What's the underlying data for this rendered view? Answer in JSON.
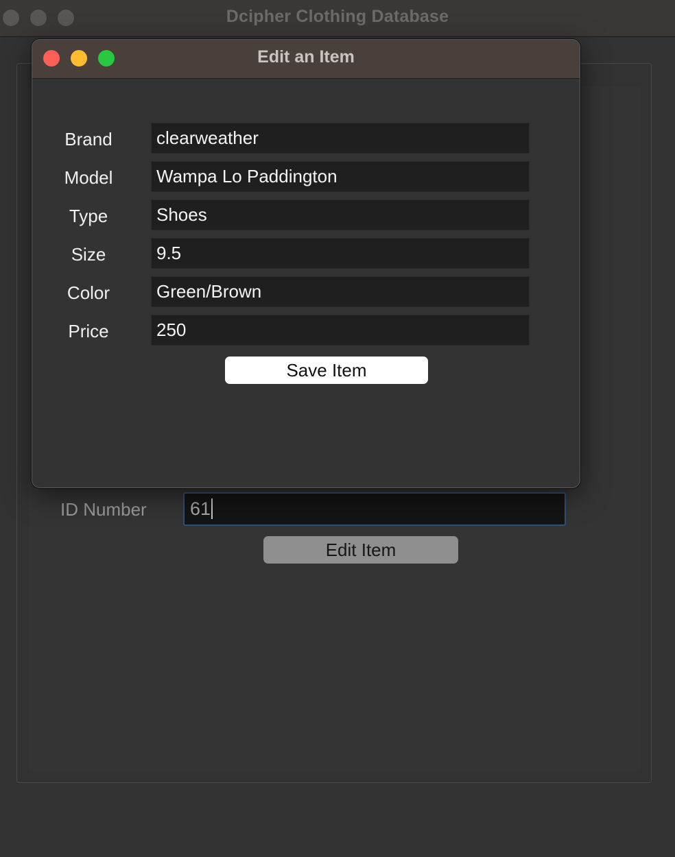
{
  "main_window": {
    "title": "Dcipher Clothing Database",
    "id_label": "ID Number",
    "id_value": "61",
    "edit_button_label": "Edit Item"
  },
  "dialog": {
    "title": "Edit an Item",
    "fields": [
      {
        "label": "Brand",
        "value": "clearweather"
      },
      {
        "label": "Model",
        "value": "Wampa Lo Paddington"
      },
      {
        "label": "Type",
        "value": "Shoes"
      },
      {
        "label": "Size",
        "value": "9.5"
      },
      {
        "label": "Color",
        "value": "Green/Brown"
      },
      {
        "label": "Price",
        "value": "250"
      }
    ],
    "save_button_label": "Save Item"
  },
  "colors": {
    "traffic_close": "#fe5f57",
    "traffic_minimize": "#febc2e",
    "traffic_zoom": "#28c840",
    "focus_ring": "#2f5179"
  },
  "icons": {
    "close": "close-button-icon",
    "minimize": "minimize-button-icon",
    "zoom": "zoom-button-icon"
  }
}
